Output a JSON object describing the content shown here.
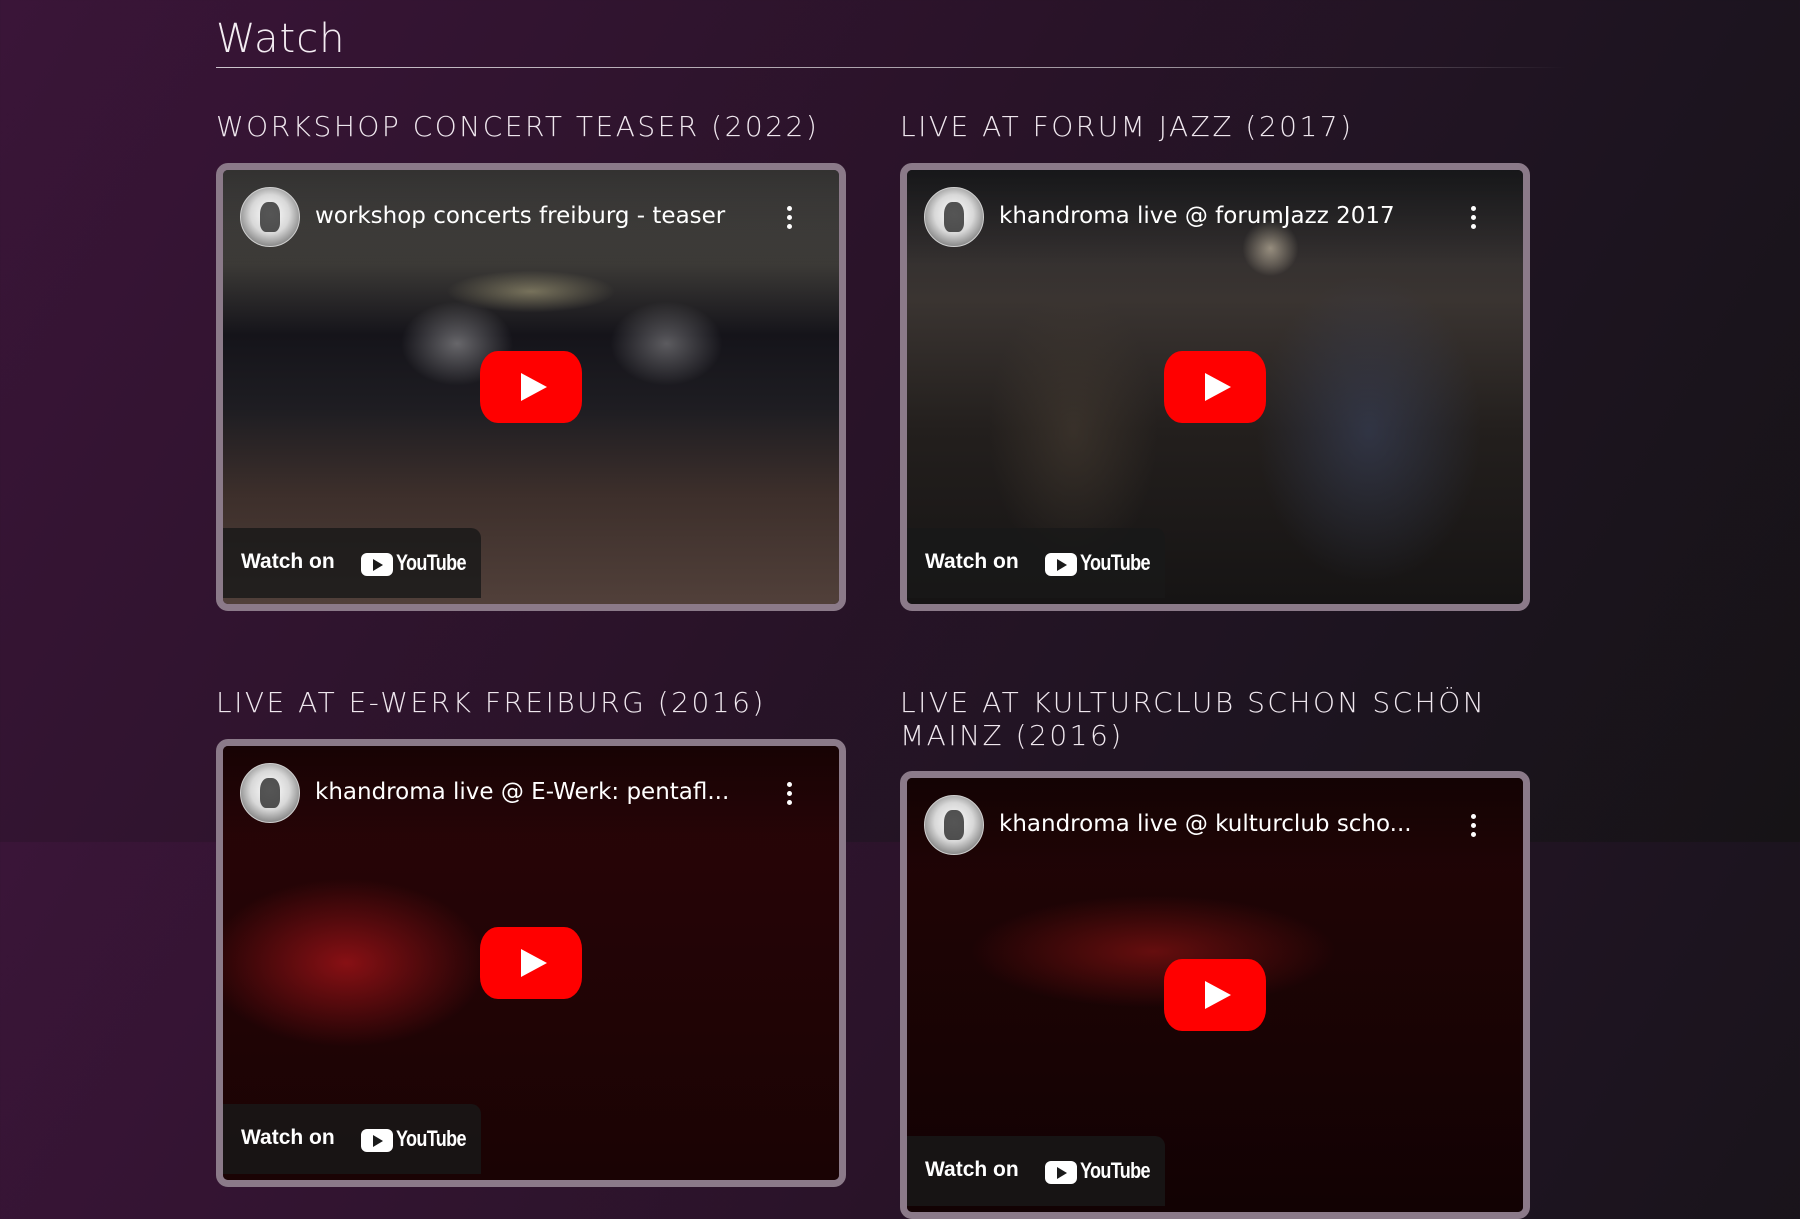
{
  "section": {
    "title": "Watch"
  },
  "videos": [
    {
      "heading": "WORKSHOP CONCERT TEASER (2022)",
      "yt_title": "workshop concerts freiburg - teaser",
      "watch_on": "Watch on",
      "youtube_wordmark": "YouTube"
    },
    {
      "heading": "LIVE AT FORUM JAZZ (2017)",
      "yt_title": "khandroma live @ forumJazz 2017",
      "watch_on": "Watch on",
      "youtube_wordmark": "YouTube"
    },
    {
      "heading": "LIVE AT E-WERK FREIBURG (2016)",
      "yt_title": "khandroma live @ E-Werk: pentafl...",
      "watch_on": "Watch on",
      "youtube_wordmark": "YouTube"
    },
    {
      "heading_line1": "LIVE AT KULTURCLUB SCHON SCHÖN",
      "heading_line2": "MAINZ (2016)",
      "yt_title": "khandroma live @ kulturclub scho...",
      "watch_on": "Watch on",
      "youtube_wordmark": "YouTube"
    }
  ],
  "colors": {
    "background": "#2a1329",
    "frame_border": "#8b7a89",
    "play_button": "#ff0000"
  },
  "icons": [
    "channel-avatar",
    "kebab-menu-icon",
    "play-icon",
    "youtube-logo-icon"
  ]
}
